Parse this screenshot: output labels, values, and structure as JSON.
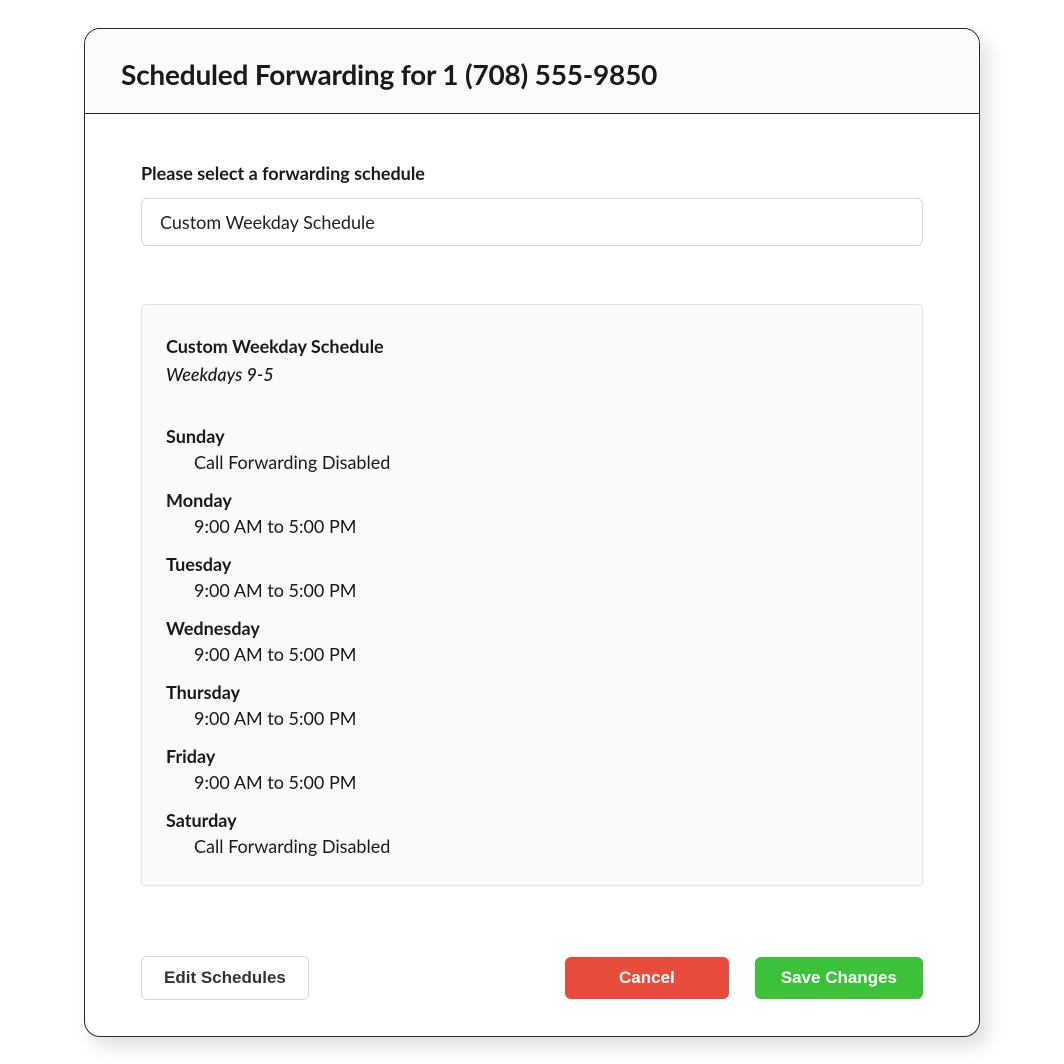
{
  "modal": {
    "title": "Scheduled Forwarding for 1 (708) 555-9850"
  },
  "field": {
    "label": "Please select a forwarding schedule",
    "selected": "Custom Weekday Schedule"
  },
  "schedule": {
    "name": "Custom Weekday Schedule",
    "description": "Weekdays 9-5",
    "days": [
      {
        "label": "Sunday",
        "value": "Call Forwarding Disabled"
      },
      {
        "label": "Monday",
        "value": "9:00 AM to 5:00 PM"
      },
      {
        "label": "Tuesday",
        "value": "9:00 AM to 5:00 PM"
      },
      {
        "label": "Wednesday",
        "value": "9:00 AM to 5:00 PM"
      },
      {
        "label": "Thursday",
        "value": "9:00 AM to 5:00 PM"
      },
      {
        "label": "Friday",
        "value": "9:00 AM to 5:00 PM"
      },
      {
        "label": "Saturday",
        "value": "Call Forwarding Disabled"
      }
    ]
  },
  "buttons": {
    "edit": "Edit Schedules",
    "cancel": "Cancel",
    "save": "Save Changes"
  }
}
